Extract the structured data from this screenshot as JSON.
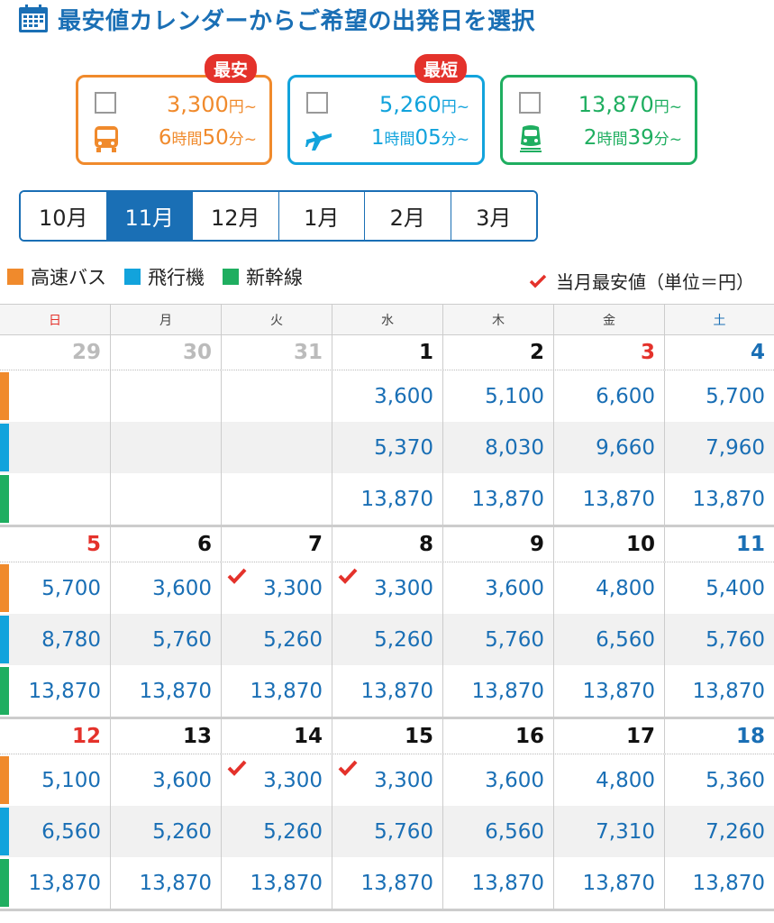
{
  "header": {
    "title": "最安値カレンダーからご希望の出発日を選択",
    "icon": "calendar-icon"
  },
  "colors": {
    "bus": "#f08a2c",
    "plane": "#12a3dc",
    "train": "#1fae60",
    "accent": "#1a6fb5",
    "red": "#e4322b"
  },
  "cards": [
    {
      "mode": "bus",
      "icon": "bus-icon",
      "price": "3,300",
      "price_unit": "円~",
      "hours": "6",
      "hours_unit": "時間",
      "minutes": "50",
      "minutes_unit": "分~",
      "badge": "最安"
    },
    {
      "mode": "plane",
      "icon": "airplane-icon",
      "price": "5,260",
      "price_unit": "円~",
      "hours": "1",
      "hours_unit": "時間",
      "minutes": "05",
      "minutes_unit": "分~",
      "badge": "最短"
    },
    {
      "mode": "train",
      "icon": "train-icon",
      "price": "13,870",
      "price_unit": "円~",
      "hours": "2",
      "hours_unit": "時間",
      "minutes": "39",
      "minutes_unit": "分~",
      "badge": ""
    }
  ],
  "months": [
    "10月",
    "11月",
    "12月",
    "1月",
    "2月",
    "3月"
  ],
  "active_month": "11月",
  "legend": {
    "bus": "高速バス",
    "plane": "飛行機",
    "train": "新幹線",
    "cheapest": "当月最安値（単位＝円）"
  },
  "weekdays": [
    "日",
    "月",
    "火",
    "水",
    "木",
    "金",
    "土"
  ],
  "weeks": [
    {
      "dates": [
        "29",
        "30",
        "31",
        "1",
        "2",
        "3",
        "4"
      ],
      "other_month": [
        true,
        true,
        true,
        false,
        false,
        false,
        false
      ],
      "holiday": [
        false,
        false,
        false,
        false,
        false,
        true,
        false
      ],
      "bus": [
        "",
        "",
        "",
        "3,600",
        "5,100",
        "6,600",
        "5,700"
      ],
      "plane": [
        "",
        "",
        "",
        "5,370",
        "8,030",
        "9,660",
        "7,960"
      ],
      "train": [
        "",
        "",
        "",
        "13,870",
        "13,870",
        "13,870",
        "13,870"
      ],
      "bus_cheapest": [
        false,
        false,
        false,
        false,
        false,
        false,
        false
      ]
    },
    {
      "dates": [
        "5",
        "6",
        "7",
        "8",
        "9",
        "10",
        "11"
      ],
      "other_month": [
        false,
        false,
        false,
        false,
        false,
        false,
        false
      ],
      "holiday": [
        false,
        false,
        false,
        false,
        false,
        false,
        false
      ],
      "bus": [
        "5,700",
        "3,600",
        "3,300",
        "3,300",
        "3,600",
        "4,800",
        "5,400"
      ],
      "plane": [
        "8,780",
        "5,760",
        "5,260",
        "5,260",
        "5,760",
        "6,560",
        "5,760"
      ],
      "train": [
        "13,870",
        "13,870",
        "13,870",
        "13,870",
        "13,870",
        "13,870",
        "13,870"
      ],
      "bus_cheapest": [
        false,
        false,
        true,
        true,
        false,
        false,
        false
      ]
    },
    {
      "dates": [
        "12",
        "13",
        "14",
        "15",
        "16",
        "17",
        "18"
      ],
      "other_month": [
        false,
        false,
        false,
        false,
        false,
        false,
        false
      ],
      "holiday": [
        false,
        false,
        false,
        false,
        false,
        false,
        false
      ],
      "bus": [
        "5,100",
        "3,600",
        "3,300",
        "3,300",
        "3,600",
        "4,800",
        "5,360"
      ],
      "plane": [
        "6,560",
        "5,260",
        "5,260",
        "5,760",
        "6,560",
        "7,310",
        "7,260"
      ],
      "train": [
        "13,870",
        "13,870",
        "13,870",
        "13,870",
        "13,870",
        "13,870",
        "13,870"
      ],
      "bus_cheapest": [
        false,
        false,
        true,
        true,
        false,
        false,
        false
      ]
    }
  ]
}
